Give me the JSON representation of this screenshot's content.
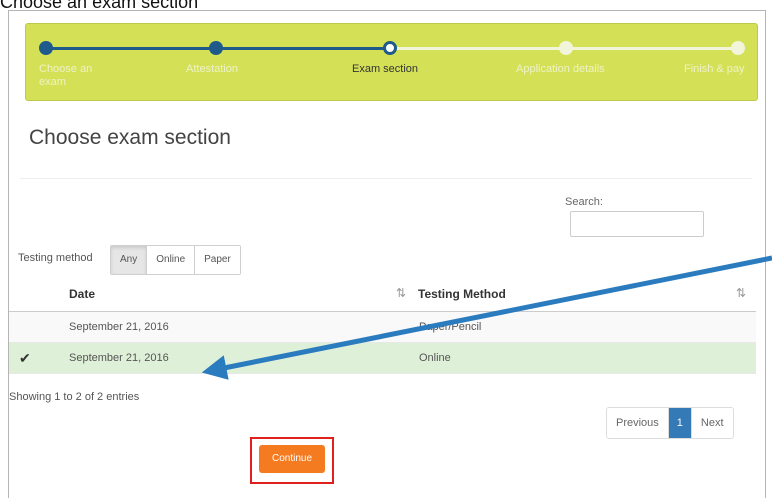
{
  "caption": "Choose an exam section",
  "stepper": {
    "steps": [
      {
        "label": "Choose an exam",
        "state": "completed"
      },
      {
        "label": "Attestation",
        "state": "completed"
      },
      {
        "label": "Exam section",
        "state": "current"
      },
      {
        "label": "Application details",
        "state": "pending"
      },
      {
        "label": "Finish & pay",
        "state": "pending"
      }
    ],
    "colors": {
      "background": "#d4e157",
      "active": "#1f5a8a",
      "pending": "#f2f5d9"
    }
  },
  "page_title": "Choose exam section",
  "search": {
    "label": "Search:",
    "value": ""
  },
  "filter": {
    "label": "Testing method",
    "options": [
      "Any",
      "Online",
      "Paper"
    ],
    "selected": "Any"
  },
  "table": {
    "columns": [
      "Date",
      "Testing Method"
    ],
    "rows": [
      {
        "date": "September 21, 2016",
        "method": "Paper/Pencil",
        "selected": false
      },
      {
        "date": "September 21, 2016",
        "method": "Online",
        "selected": true
      }
    ],
    "selected_icon": "checkmark-icon",
    "sort_icons": [
      "sort-asc-icon",
      "sort-both-icon"
    ]
  },
  "info_text": "Showing 1 to 2 of 2 entries",
  "pagination": {
    "previous": "Previous",
    "current_page": "1",
    "next": "Next"
  },
  "continue_label": "Continue",
  "annotations": {
    "arrow_color": "#2b7bbf",
    "highlight_color": "#e0201c",
    "button_color": "#f47b20"
  }
}
